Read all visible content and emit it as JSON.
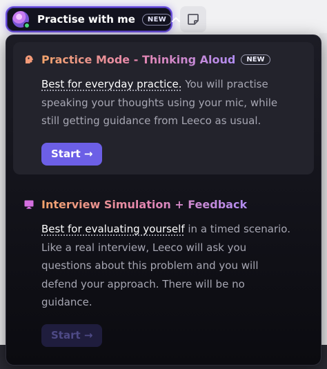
{
  "pill": {
    "label": "Practise with me",
    "badge": "NEW",
    "chevron": "^"
  },
  "icons": {
    "avatar": "avatar-icon",
    "chevron": "chevron-up-icon",
    "note": "sticky-note-icon",
    "practice": "speaking-head-icon",
    "interview": "monitor-icon"
  },
  "colors": {
    "accent": "#6c5fe6",
    "pill_border": "#6b4fe0",
    "title_gradient_start": "#f2a36b",
    "title_gradient_end": "#b18cf2",
    "online": "#4ade80"
  },
  "modes": [
    {
      "title": "Practice Mode - Thinking Aloud",
      "badge": "NEW",
      "highlight": "Best for everyday practice.",
      "description": " You will practise speaking your thoughts using your mic, while still getting guidance from Leeco as usual.",
      "button": "Start →",
      "enabled": true
    },
    {
      "title": "Interview Simulation + Feedback",
      "highlight": "Best for evaluating yourself",
      "description": " in a timed scenario. Like a real interview, Leeco will ask you questions about this problem and you will defend your approach. There will be no guidance.",
      "button": "Start →",
      "enabled": false
    }
  ]
}
